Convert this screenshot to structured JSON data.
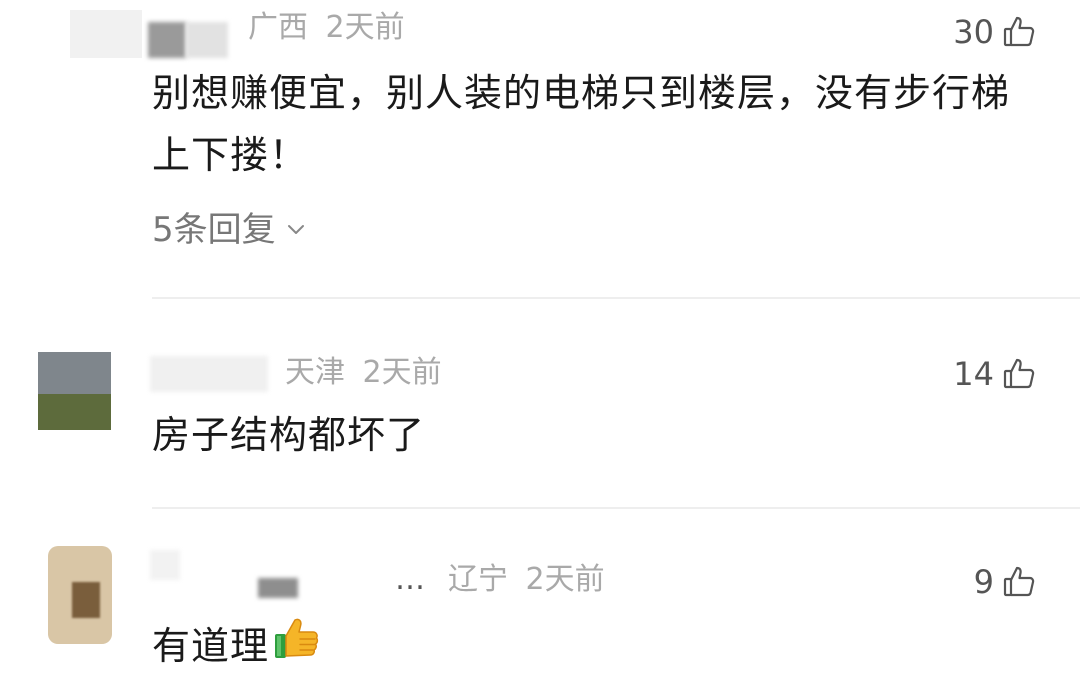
{
  "comments": [
    {
      "location": "广西",
      "time": "2天前",
      "likes": "30",
      "text_lines": [
        "别想赚便宜，别人装的电梯只到楼层，没有步行梯",
        "上下搂！"
      ],
      "replies_label": "5条回复"
    },
    {
      "location": "天津",
      "time": "2天前",
      "likes": "14",
      "text": "房子结构都坏了"
    },
    {
      "location": "辽宁",
      "time": "2天前",
      "likes": "9",
      "text": "有道理",
      "name_ellipsis": "…"
    }
  ],
  "icons": {
    "like": "thumbs-up-outline-icon",
    "chevron": "chevron-down-icon",
    "emoji": "thumbs-up-emoji-icon"
  },
  "colors": {
    "text": "#1a1a1a",
    "meta": "#a9a9a9",
    "divider": "#eeeeee",
    "background": "#ffffff"
  }
}
